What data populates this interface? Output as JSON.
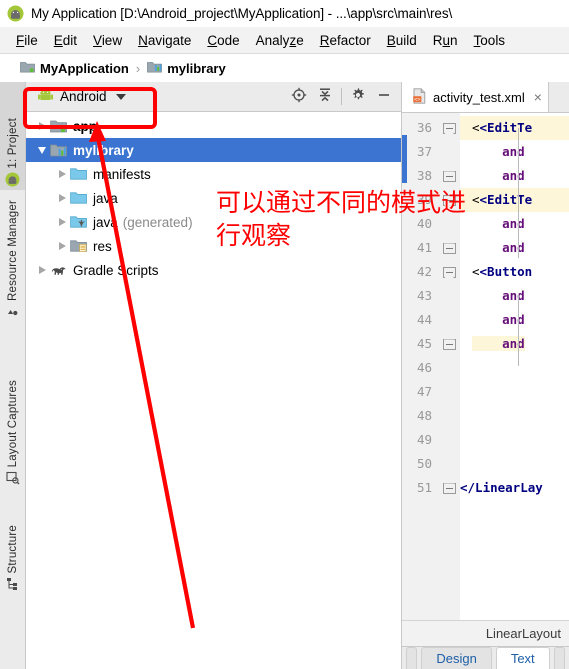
{
  "window": {
    "title": "My Application [D:\\Android_project\\MyApplication] - ...\\app\\src\\main\\res\\",
    "logo_icon": "android-studio-logo-icon"
  },
  "menubar": {
    "items": [
      {
        "label": "File",
        "pre": "F",
        "post": "ile"
      },
      {
        "label": "Edit",
        "pre": "E",
        "post": "dit"
      },
      {
        "label": "View",
        "pre": "V",
        "post": "iew"
      },
      {
        "label": "Navigate",
        "pre": "N",
        "post": "avigate"
      },
      {
        "label": "Code",
        "pre": "C",
        "post": "ode"
      },
      {
        "label": "Analyze",
        "pre": "",
        "post": "Analyze"
      },
      {
        "label": "Refactor",
        "pre": "R",
        "post": "efactor"
      },
      {
        "label": "Build",
        "pre": "B",
        "post": "uild"
      },
      {
        "label": "Run",
        "pre": "",
        "post": "Run"
      },
      {
        "label": "Tools",
        "pre": "T",
        "post": "ools"
      }
    ]
  },
  "breadcrumb": {
    "items": [
      {
        "label": "MyApplication",
        "icon": "module-folder-icon"
      },
      {
        "label": "mylibrary",
        "icon": "library-module-icon"
      }
    ],
    "separator": "›"
  },
  "toolstrip": {
    "tabs": [
      {
        "label": "1: Project",
        "icon": "android-icon",
        "active": true
      },
      {
        "label": "Resource Manager",
        "icon": "resource-manager-icon",
        "active": false
      },
      {
        "label": "Layout Captures",
        "icon": "layout-captures-icon",
        "active": false
      },
      {
        "label": "Structure",
        "icon": "structure-icon",
        "active": false
      }
    ]
  },
  "project_panel": {
    "view_selector": {
      "label": "Android",
      "icon": "android-head-icon",
      "caret": "chevron-down-icon"
    },
    "toolbar_buttons": [
      {
        "name": "locate-in-tree-button",
        "icon": "target-icon",
        "title": "Select Opened File"
      },
      {
        "name": "collapse-all-button",
        "icon": "collapse-all-icon",
        "title": "Collapse All"
      },
      {
        "name": "settings-button",
        "icon": "gear-icon",
        "title": "Settings"
      },
      {
        "name": "hide-panel-button",
        "icon": "minimize-icon",
        "title": "Hide"
      }
    ],
    "tree": [
      {
        "label": "app",
        "icon": "app-module-icon",
        "indent": 0,
        "expanded": false,
        "selected": false,
        "bold": true,
        "sub": ""
      },
      {
        "label": "mylibrary",
        "icon": "library-module-icon",
        "indent": 0,
        "expanded": true,
        "selected": true,
        "bold": true,
        "sub": ""
      },
      {
        "label": "manifests",
        "icon": "folder-blue-icon",
        "indent": 1,
        "expanded": false,
        "selected": false,
        "bold": false,
        "sub": ""
      },
      {
        "label": "java",
        "icon": "folder-blue-icon",
        "indent": 1,
        "expanded": false,
        "selected": false,
        "bold": false,
        "sub": ""
      },
      {
        "label": "java",
        "icon": "folder-generated-icon",
        "indent": 1,
        "expanded": false,
        "selected": false,
        "bold": false,
        "sub": "(generated)"
      },
      {
        "label": "res",
        "icon": "folder-res-icon",
        "indent": 1,
        "expanded": false,
        "selected": false,
        "bold": false,
        "sub": ""
      },
      {
        "label": "Gradle Scripts",
        "icon": "gradle-elephant-icon",
        "indent": 0,
        "expanded": false,
        "selected": false,
        "bold": false,
        "sub": ""
      }
    ]
  },
  "editor": {
    "tab": {
      "label": "activity_test.xml",
      "icon": "xml-file-icon",
      "close": "×"
    },
    "line_numbers": [
      "36",
      "37",
      "38",
      "39",
      "40",
      "41",
      "42",
      "43",
      "44",
      "45",
      "46",
      "47",
      "48",
      "49",
      "50",
      "51"
    ],
    "lines": [
      {
        "num": "36",
        "text": "<EditTe",
        "kind": "tag",
        "highlight": true,
        "fold": "point"
      },
      {
        "num": "37",
        "text": "    and",
        "kind": "attr",
        "highlight": false,
        "fold": ""
      },
      {
        "num": "38",
        "text": "    and",
        "kind": "attr",
        "highlight": false,
        "fold": "end"
      },
      {
        "num": "39",
        "text": "<EditTe",
        "kind": "tag",
        "highlight": true,
        "fold": "point"
      },
      {
        "num": "40",
        "text": "    and",
        "kind": "attr",
        "highlight": false,
        "fold": ""
      },
      {
        "num": "41",
        "text": "    and",
        "kind": "attr",
        "highlight": false,
        "fold": "end"
      },
      {
        "num": "42",
        "text": "<Button",
        "kind": "tag",
        "highlight": false,
        "fold": "point"
      },
      {
        "num": "43",
        "text": "    and",
        "kind": "attr",
        "highlight": false,
        "fold": ""
      },
      {
        "num": "44",
        "text": "    and",
        "kind": "attr",
        "highlight": false,
        "fold": ""
      },
      {
        "num": "45",
        "text": "    and",
        "kind": "attr",
        "highlight": true,
        "fold": "end"
      },
      {
        "num": "46",
        "text": "",
        "kind": "plain",
        "highlight": false,
        "fold": ""
      },
      {
        "num": "47",
        "text": "",
        "kind": "plain",
        "highlight": false,
        "fold": ""
      },
      {
        "num": "48",
        "text": "",
        "kind": "plain",
        "highlight": false,
        "fold": ""
      },
      {
        "num": "49",
        "text": "",
        "kind": "plain",
        "highlight": false,
        "fold": ""
      },
      {
        "num": "50",
        "text": "",
        "kind": "plain",
        "highlight": false,
        "fold": ""
      },
      {
        "num": "51",
        "text": "</LinearLay",
        "kind": "tag",
        "highlight": false,
        "fold": "end"
      }
    ],
    "status_breadcrumb": "LinearLayout",
    "bottom_tabs": [
      {
        "label": "Design",
        "active": false
      },
      {
        "label": "Text",
        "active": true
      }
    ]
  },
  "annotations": {
    "text_line1": "可以通过不同的模式进",
    "text_line2": "行观察",
    "color": "#ff0000",
    "highlight_box_target": "Android view selector",
    "arrow_from": "Android view selector",
    "arrow_to": "project tree lower area"
  },
  "colors": {
    "selection_blue": "#3b75d1",
    "annotation_red": "#ff0000",
    "toolbar_gray": "#ebebeb",
    "gutter_gray": "#f1f1f1",
    "tag_navy": "#000080",
    "attr_purple": "#660e7a",
    "highlight_yellow": "#fdf6d8"
  }
}
